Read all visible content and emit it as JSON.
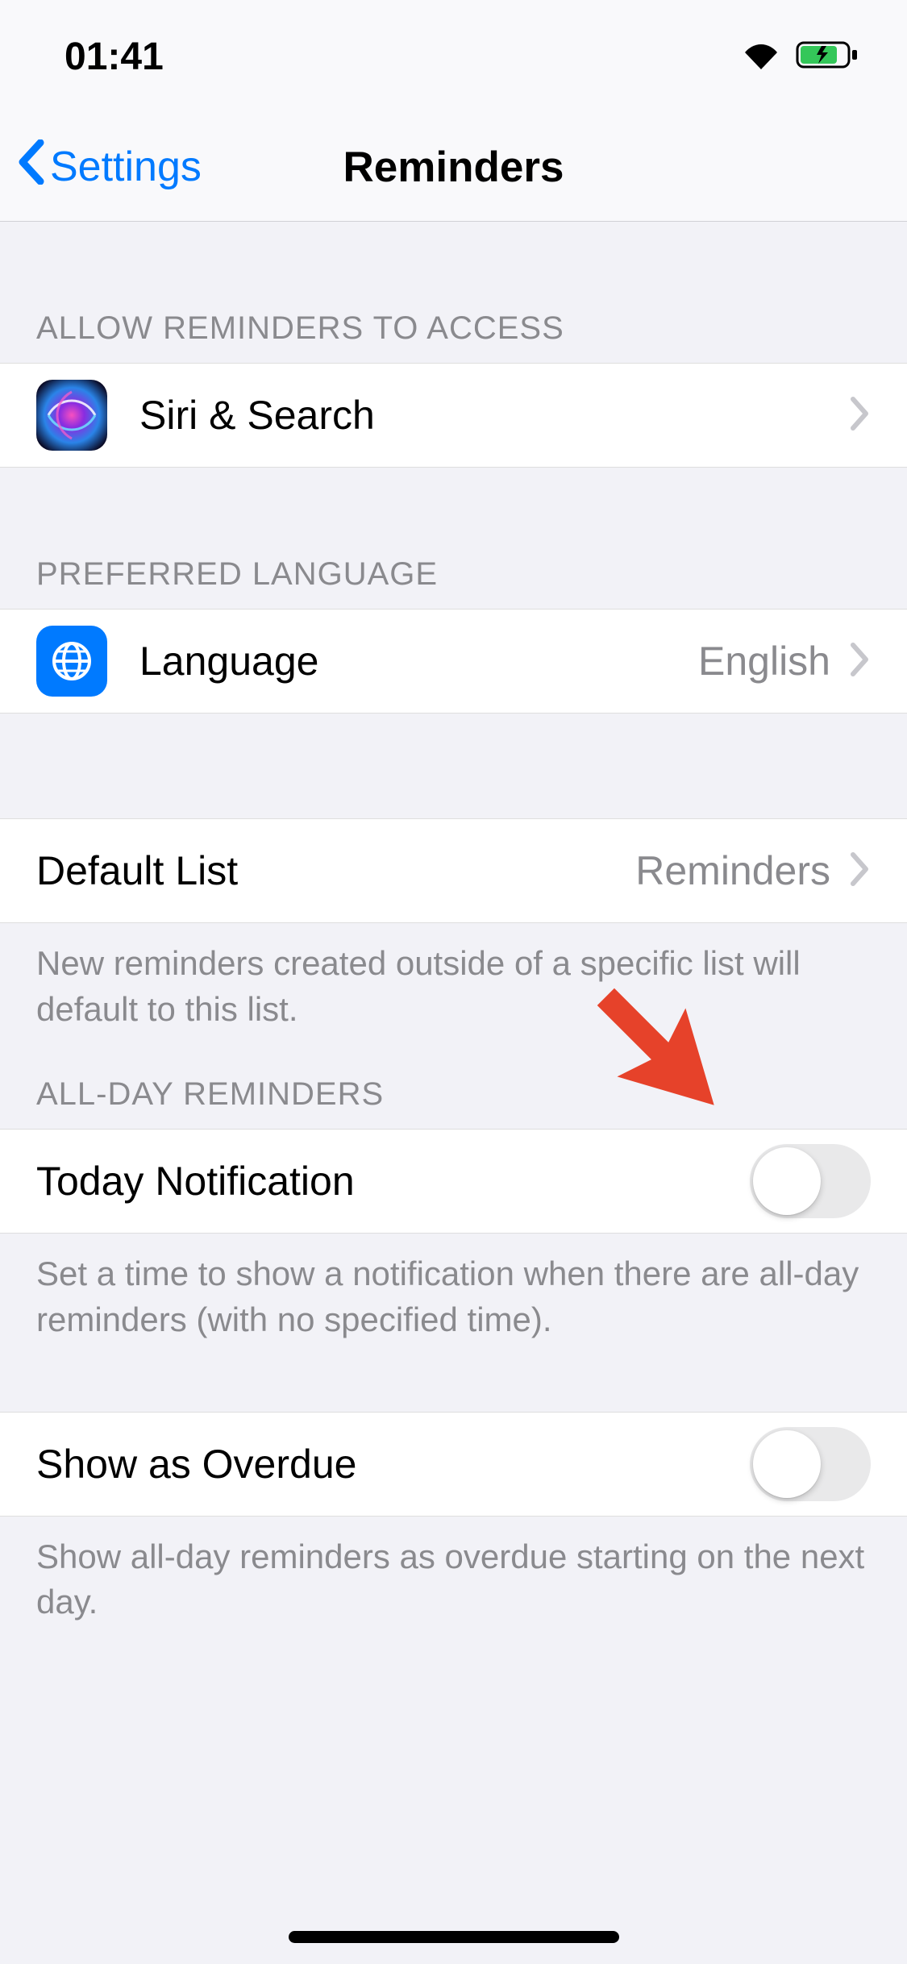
{
  "status": {
    "time": "01:41"
  },
  "nav": {
    "back_label": "Settings",
    "title": "Reminders"
  },
  "sections": {
    "access_header": "ALLOW REMINDERS TO ACCESS",
    "language_header": "PREFERRED LANGUAGE",
    "allday_header": "ALL-DAY REMINDERS"
  },
  "rows": {
    "siri": {
      "label": "Siri & Search"
    },
    "language": {
      "label": "Language",
      "value": "English"
    },
    "default_list": {
      "label": "Default List",
      "value": "Reminders"
    },
    "today_notification": {
      "label": "Today Notification"
    },
    "show_overdue": {
      "label": "Show as Overdue"
    }
  },
  "footers": {
    "default_list": "New reminders created outside of a specific list will default to this list.",
    "today_notification": "Set a time to show a notification when there are all-day reminders (with no specified time).",
    "show_overdue": "Show all-day reminders as overdue starting on the next day."
  }
}
